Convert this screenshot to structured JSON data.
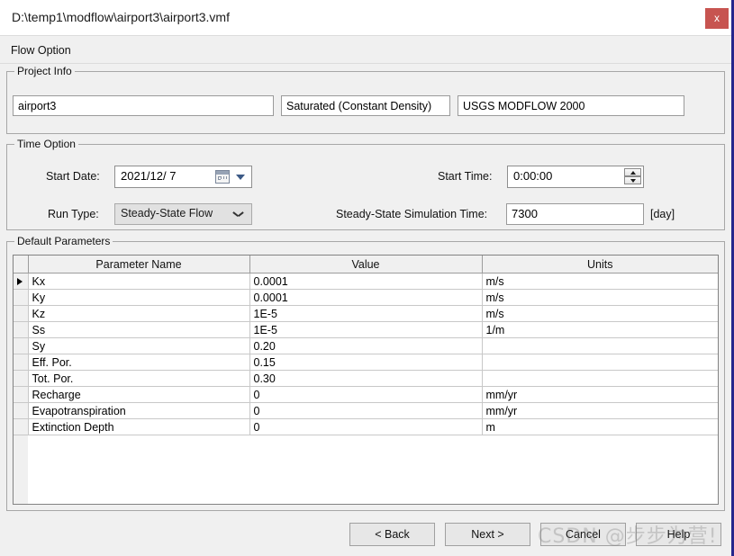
{
  "window": {
    "title": "D:\\temp1\\modflow\\airport3\\airport3.vmf",
    "close_label": "x",
    "accent_close_color": "#c75450",
    "right_border_color": "#26268c"
  },
  "menubar": {
    "items": [
      {
        "label": "Flow Option"
      }
    ]
  },
  "project_info": {
    "legend": "Project Info",
    "project_name": "airport3",
    "flow_type": "Saturated (Constant Density)",
    "model": "USGS MODFLOW 2000"
  },
  "time_option": {
    "legend": "Time Option",
    "start_date_label": "Start Date:",
    "start_date_value": "2021/12/  7",
    "run_type_label": "Run Type:",
    "run_type_value": "Steady-State Flow",
    "start_time_label": "Start Time:",
    "start_time_value": "0:00:00",
    "sim_time_label": "Steady-State Simulation Time:",
    "sim_time_value": "7300",
    "sim_time_unit": "[day]"
  },
  "default_parameters": {
    "legend": "Default Parameters",
    "columns": [
      "Parameter Name",
      "Value",
      "Units"
    ],
    "rows": [
      {
        "name": "Kx",
        "value": "0.0001",
        "units": "m/s",
        "selected": true
      },
      {
        "name": "Ky",
        "value": "0.0001",
        "units": "m/s",
        "selected": false
      },
      {
        "name": "Kz",
        "value": "1E-5",
        "units": "m/s",
        "selected": false
      },
      {
        "name": "Ss",
        "value": "1E-5",
        "units": "1/m",
        "selected": false
      },
      {
        "name": "Sy",
        "value": "0.20",
        "units": "",
        "selected": false
      },
      {
        "name": "Eff. Por.",
        "value": "0.15",
        "units": "",
        "selected": false
      },
      {
        "name": "Tot. Por.",
        "value": "0.30",
        "units": "",
        "selected": false
      },
      {
        "name": "Recharge",
        "value": "0",
        "units": "mm/yr",
        "selected": false
      },
      {
        "name": "Evapotranspiration",
        "value": "0",
        "units": "mm/yr",
        "selected": false
      },
      {
        "name": "Extinction Depth",
        "value": "0",
        "units": "m",
        "selected": false
      }
    ]
  },
  "buttons": {
    "back": "< Back",
    "next": "Next >",
    "cancel": "Cancel",
    "help": "Help"
  },
  "watermark": {
    "text": "CSDN @步步为营!"
  }
}
